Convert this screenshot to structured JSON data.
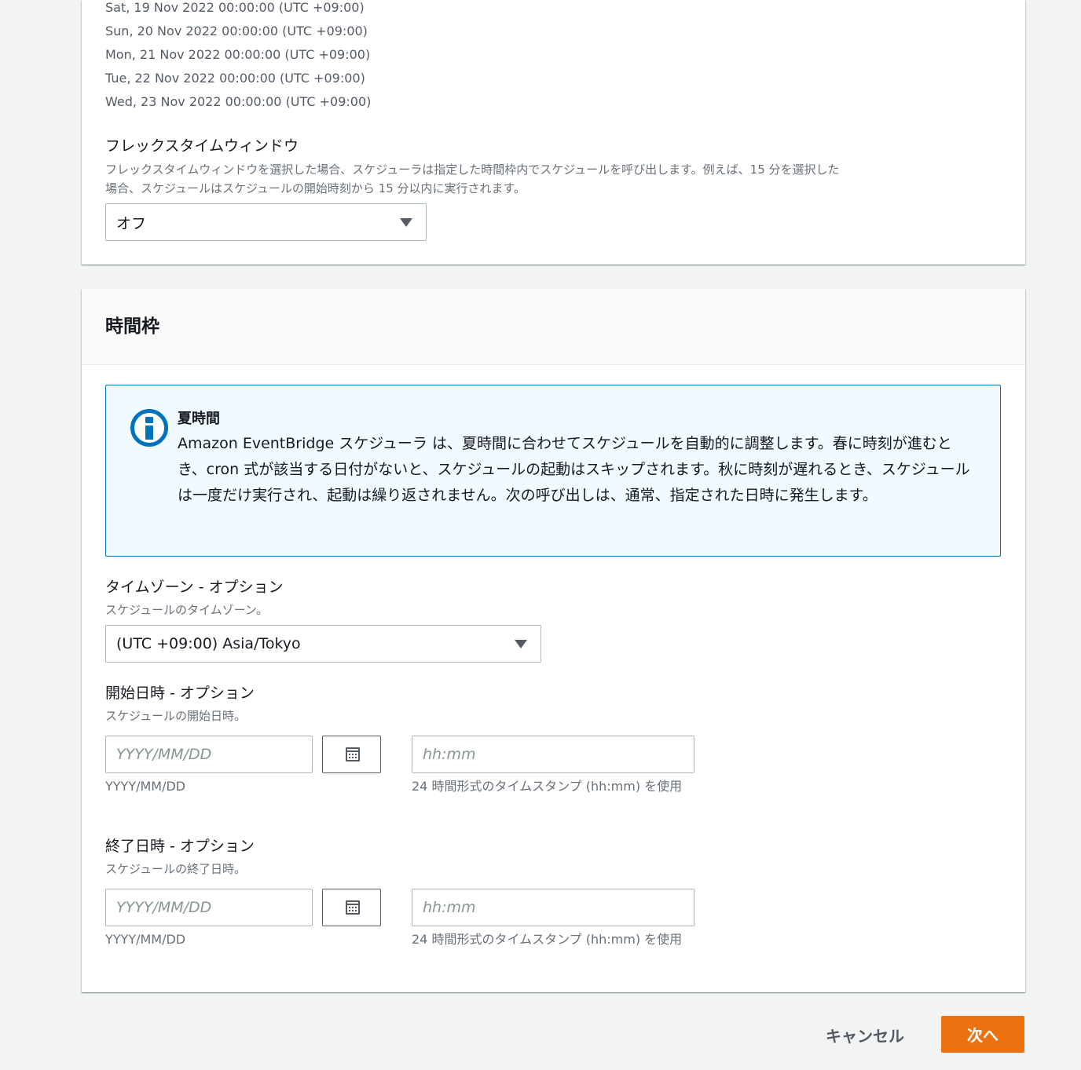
{
  "schedule_preview": {
    "occurrences": [
      "Sat, 19 Nov 2022 00:00:00 (UTC +09:00)",
      "Sun, 20 Nov 2022 00:00:00 (UTC +09:00)",
      "Mon, 21 Nov 2022 00:00:00 (UTC +09:00)",
      "Tue, 22 Nov 2022 00:00:00 (UTC +09:00)",
      "Wed, 23 Nov 2022 00:00:00 (UTC +09:00)"
    ]
  },
  "flex_window": {
    "label": "フレックスタイムウィンドウ",
    "description_line1": "フレックスタイムウィンドウを選択した場合、スケジューラは指定した時間枠内でスケジュールを呼び出します。例えば、15 分を選択した",
    "description_line2": "場合、スケジュールはスケジュールの開始時刻から 15 分以内に実行されます。",
    "selected": "オフ"
  },
  "timeframe": {
    "heading": "時間枠",
    "alert": {
      "title": "夏時間",
      "body": "Amazon EventBridge スケジューラ は、夏時間に合わせてスケジュールを自動的に調整します。春に時刻が進むとき、cron 式が該当する日付がないと、スケジュールの起動はスキップされます。秋に時刻が遅れるとき、スケジュールは一度だけ実行され、起動は繰り返されません。次の呼び出しは、通常、指定された日時に発生します。"
    },
    "timezone": {
      "label": "タイムゾーン - オプション",
      "description": "スケジュールのタイムゾーン。",
      "selected": "(UTC +09:00) Asia/Tokyo"
    },
    "start": {
      "label": "開始日時 - オプション",
      "description": "スケジュールの開始日時。",
      "date_placeholder": "YYYY/MM/DD",
      "date_hint": "YYYY/MM/DD",
      "time_placeholder": "hh:mm",
      "time_hint": "24 時間形式のタイムスタンプ (hh:mm) を使用"
    },
    "end": {
      "label": "終了日時 - オプション",
      "description": "スケジュールの終了日時。",
      "date_placeholder": "YYYY/MM/DD",
      "date_hint": "YYYY/MM/DD",
      "time_placeholder": "hh:mm",
      "time_hint": "24 時間形式のタイムスタンプ (hh:mm) を使用"
    }
  },
  "footer": {
    "cancel_label": "キャンセル",
    "next_label": "次へ"
  },
  "colors": {
    "primary_button": "#ec7211",
    "info_border": "#0073bb",
    "info_background": "#f1faff"
  }
}
